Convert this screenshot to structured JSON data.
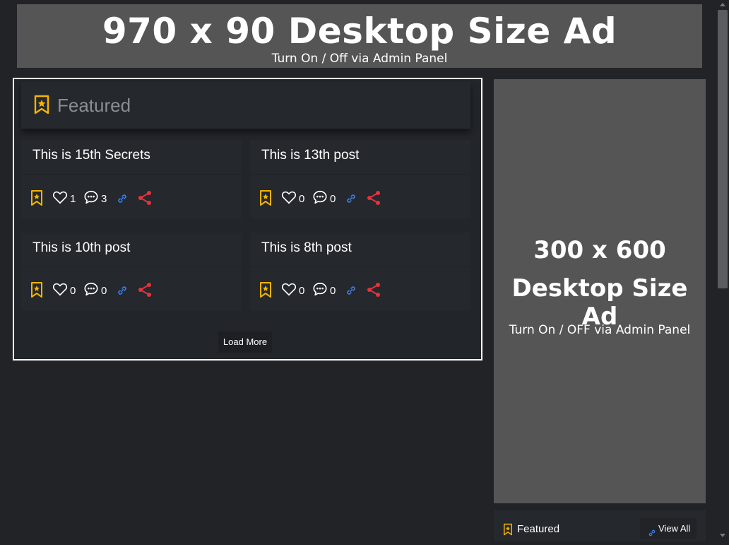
{
  "top_ad": {
    "headline": "970 x 90 Desktop Size Ad",
    "subtext": "Turn On / Off via Admin Panel"
  },
  "featured": {
    "title": "Featured",
    "icon": "bookmark-star-icon",
    "posts": [
      {
        "title": "This is 15th Secrets",
        "likes": "1",
        "comments": "3"
      },
      {
        "title": "This is 13th post",
        "likes": "0",
        "comments": "0"
      },
      {
        "title": "This is 10th post",
        "likes": "0",
        "comments": "0"
      },
      {
        "title": "This is 8th post",
        "likes": "0",
        "comments": "0"
      }
    ],
    "load_more": "Load More"
  },
  "side_ad": {
    "line1": "300 x 600",
    "line2": "Desktop Size Ad",
    "line3": "Turn On / OFF via Admin Panel"
  },
  "side_featured": {
    "title": "Featured",
    "view_all": "View All"
  },
  "colors": {
    "background": "#212327",
    "card": "#25282d",
    "accent_bookmark": "#f5b400",
    "accent_link": "#3b82f6",
    "accent_share": "#e5323e",
    "ad_placeholder": "#555555"
  }
}
